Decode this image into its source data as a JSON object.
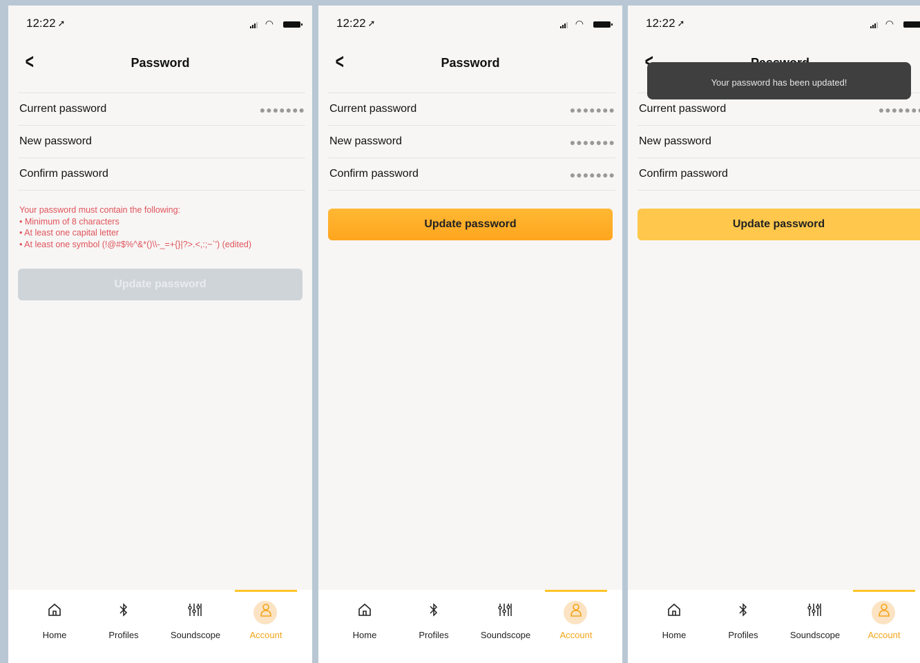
{
  "screens": [
    {
      "status_time": "12:22",
      "nav_title": "Password",
      "rows": [
        {
          "label": "Current password",
          "value": "●●●●●●●"
        },
        {
          "label": "New password",
          "value": ""
        },
        {
          "label": "Confirm password",
          "value": ""
        }
      ],
      "requirements": {
        "heading": "Your password must contain the following:",
        "items": [
          "Minimum of 8 characters",
          "At least one capital letter",
          "At least one symbol (!@#$%^&*()\\\\-_=+{}|?>.<,:;~`') (edited)"
        ]
      },
      "button_label": "Update password"
    },
    {
      "status_time": "12:22",
      "nav_title": "Password",
      "rows": [
        {
          "label": "Current password",
          "value": "●●●●●●●"
        },
        {
          "label": "New password",
          "value": "●●●●●●●"
        },
        {
          "label": "Confirm password",
          "value": "●●●●●●●"
        }
      ],
      "button_label": "Update password"
    },
    {
      "status_time": "12:22",
      "nav_title": "Password",
      "toast": "Your password has been updated!",
      "rows": [
        {
          "label": "Current password",
          "value": "●●●●●●●"
        },
        {
          "label": "New password",
          "value": ""
        },
        {
          "label": "Confirm password",
          "value": ""
        }
      ],
      "button_label": "Update password"
    }
  ],
  "tabs": [
    {
      "label": "Home",
      "icon": "home-icon"
    },
    {
      "label": "Profiles",
      "icon": "bluetooth-icon"
    },
    {
      "label": "Soundscope",
      "icon": "equalizer-icon"
    },
    {
      "label": "Account",
      "icon": "account-icon",
      "active": true
    }
  ],
  "colors": {
    "accent": "#ffa51e",
    "accent_soft": "#ffc84c",
    "error": "#e0535a",
    "disabled": "#cfd4d9",
    "tab_active": "#f3a51a"
  }
}
